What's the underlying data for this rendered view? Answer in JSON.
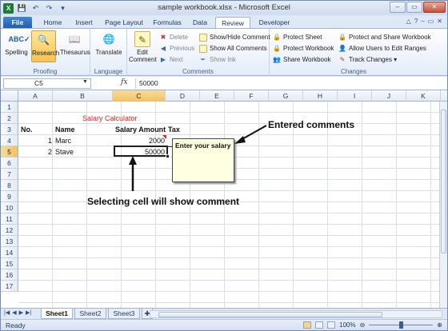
{
  "window": {
    "title": "sample workbook.xlsx  -  Microsoft Excel",
    "controls": {
      "minimize": "–",
      "maximize": "▭",
      "close": "✕"
    }
  },
  "ribbon_tabs": [
    "File",
    "Home",
    "Insert",
    "Page Layout",
    "Formulas",
    "Data",
    "Review",
    "Developer"
  ],
  "active_tab": "Review",
  "ribbon": {
    "proofing": {
      "label": "Proofing",
      "spelling": "Spelling",
      "research": "Research",
      "thesaurus": "Thesaurus"
    },
    "language": {
      "label": "Language",
      "translate": "Translate"
    },
    "comments": {
      "label": "Comments",
      "edit_comment": "Edit Comment",
      "delete": "Delete",
      "previous": "Previous",
      "next": "Next",
      "show_hide": "Show/Hide Comment",
      "show_all": "Show All Comments",
      "show_ink": "Show Ink"
    },
    "changes": {
      "label": "Changes",
      "protect_sheet": "Protect Sheet",
      "protect_workbook": "Protect Workbook",
      "share_workbook": "Share Workbook",
      "protect_and_share": "Protect and Share Workbook",
      "allow_users": "Allow Users to Edit Ranges",
      "track_changes": "Track Changes ▾"
    }
  },
  "formula_bar": {
    "name_box": "C5",
    "fx": "fx",
    "value": "50000"
  },
  "grid": {
    "columns": [
      "A",
      "B",
      "C",
      "D",
      "E",
      "F",
      "G",
      "H",
      "I",
      "J",
      "K"
    ],
    "active_column": "C",
    "rows": [
      "1",
      "2",
      "3",
      "4",
      "5",
      "6",
      "7",
      "8",
      "9",
      "10",
      "11",
      "12",
      "13",
      "14",
      "15",
      "16",
      "17"
    ],
    "active_row": "5",
    "cells": {
      "title": "Salary Calculator",
      "header_no": "No.",
      "header_name": "Name",
      "header_salary": "Salary Amount",
      "header_tax": "Tax",
      "r4_no": "1",
      "r4_name": "Marc",
      "r4_salary": "2000",
      "r5_no": "2",
      "r5_name": "Stave",
      "r5_salary": "50000"
    },
    "comment_text": "Enter your salary"
  },
  "annotations": {
    "entered_comments": "Entered comments",
    "selecting_cell": "Selecting cell will show comment"
  },
  "sheets": [
    "Sheet1",
    "Sheet2",
    "Sheet3"
  ],
  "active_sheet": "Sheet1",
  "status": {
    "mode": "Ready",
    "zoom": "100%",
    "zoom_level": 0.5
  }
}
